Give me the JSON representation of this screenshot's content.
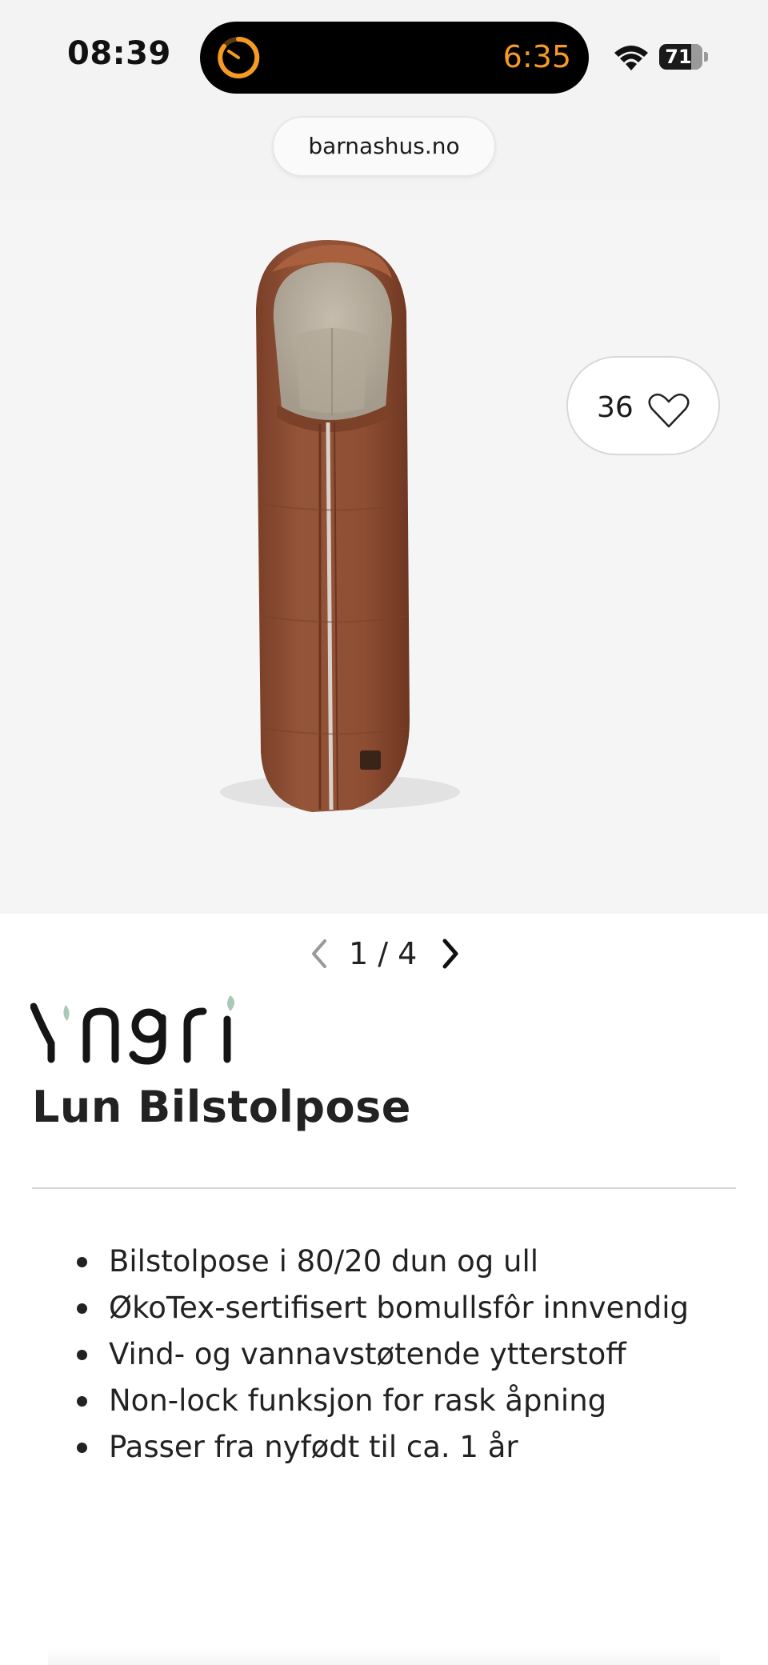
{
  "status_bar": {
    "time": "08:39",
    "timer": "6:35",
    "battery": "71",
    "battery_level": 0.71,
    "accent_color": "#f59a23",
    "icons": [
      "timer-icon",
      "wifi-icon",
      "battery-icon"
    ]
  },
  "browser": {
    "url": "barnashus.no"
  },
  "gallery": {
    "wishlist_count": "36",
    "wishlist_icon": "heart-outline-icon",
    "product_color": "#8b4a31",
    "lining_color": "#b7ad9f"
  },
  "pager": {
    "text": "1 / 4",
    "prev_icon": "chevron-left-icon",
    "next_icon": "chevron-right-icon"
  },
  "product": {
    "brand": "Yngri",
    "title": "Lun Bilstolpose",
    "features": [
      "Bilstolpose i 80/20 dun og ull",
      "ØkoTex-sertifisert bomullsfôr innvendig",
      "Vind- og vannavstøtende ytterstoff",
      "Non-lock funksjon for rask åpning",
      "Passer fra nyfødt til ca. 1 år"
    ]
  }
}
